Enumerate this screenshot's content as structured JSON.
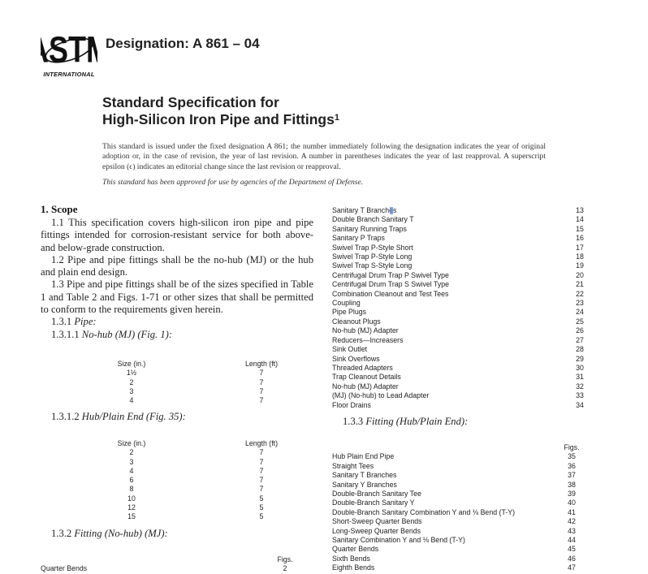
{
  "header": {
    "logo": {
      "name": "astm-logo",
      "caption": "INTERNATIONAL"
    },
    "designation": "Designation: A 861 – 04"
  },
  "title": {
    "line1": "Standard Specification for",
    "line2": "High-Silicon Iron Pipe and Fittings",
    "footnote": "1"
  },
  "notice": "This standard is issued under the fixed designation A 861; the number immediately following the designation indicates the year of original adoption or, in the case of revision, the year of last revision. A number in parentheses indicates the year of last reapproval. A superscript epsilon (ϵ) indicates an editorial change since the last revision or reapproval.",
  "approved": "This standard has been approved for use by agencies of the Department of Defense.",
  "scope": {
    "heading": "1. Scope",
    "p1": "1.1 This specification covers high-silicon iron pipe and pipe fittings intended for corrosion-resistant service for both above- and below-grade construction.",
    "p2": "1.2 Pipe and pipe fittings shall be the no-hub (MJ) or the hub and plain end design.",
    "p3": "1.3 Pipe and pipe fittings shall be of the sizes specified in Table 1 and Table 2 and Figs. 1-71 or other sizes that shall be permitted to conform to the requirements given herein.",
    "s131_num": "1.3.1",
    "s131_label": "Pipe:",
    "s1311_num": "1.3.1.1",
    "s1311_label": "No-hub (MJ) (Fig. 1):",
    "s1312_num": "1.3.1.2",
    "s1312_label": "Hub/Plain End (Fig. 35):",
    "s132_num": "1.3.2",
    "s132_label": "Fitting (No-hub) (MJ):",
    "s133_num": "1.3.3",
    "s133_label": "Fitting (Hub/Plain End):"
  },
  "table_nohub": {
    "headers": [
      "Size (in.)",
      "Length (ft)"
    ],
    "rows": [
      [
        "1½",
        "7"
      ],
      [
        "2",
        "7"
      ],
      [
        "3",
        "7"
      ],
      [
        "4",
        "7"
      ]
    ]
  },
  "table_hub": {
    "headers": [
      "Size (in.)",
      "Length (ft)"
    ],
    "rows": [
      [
        "2",
        "7"
      ],
      [
        "3",
        "7"
      ],
      [
        "4",
        "7"
      ],
      [
        "6",
        "7"
      ],
      [
        "8",
        "7"
      ],
      [
        "10",
        "5"
      ],
      [
        "12",
        "5"
      ],
      [
        "15",
        "5"
      ]
    ]
  },
  "fitting_nohub_left": {
    "figs_header": "Figs.",
    "rows": [
      [
        "Quarter Bends",
        "2"
      ]
    ]
  },
  "fitting_nohub_right": {
    "rows": [
      [
        "Sanitary T Branches",
        "13"
      ],
      [
        "Double Branch Sanitary T",
        "14"
      ],
      [
        "Sanitary Running Traps",
        "15"
      ],
      [
        "Sanitary P Traps",
        "16"
      ],
      [
        "Swivel Trap P-Style Short",
        "17"
      ],
      [
        "Swivel Trap P-Style Long",
        "18"
      ],
      [
        "Swivel Trap S-Style Long",
        "19"
      ],
      [
        "Centrifugal Drum Trap P Swivel Type",
        "20"
      ],
      [
        "Centrifugal Drum Trap S Swivel Type",
        "21"
      ],
      [
        "Combination Cleanout and Test Tees",
        "22"
      ],
      [
        "Coupling",
        "23"
      ],
      [
        "Pipe Plugs",
        "24"
      ],
      [
        "Cleanout Plugs",
        "25"
      ],
      [
        "No-hub (MJ) Adapter",
        "26"
      ],
      [
        "Reducers—Increasers",
        "27"
      ],
      [
        "Sink Outlet",
        "28"
      ],
      [
        "Sink Overflows",
        "29"
      ],
      [
        "Threaded Adapters",
        "30"
      ],
      [
        "Trap Cleanout Details",
        "31"
      ],
      [
        "No-hub (MJ) Adapter",
        "32"
      ],
      [
        "(MJ) (No-hub) to Lead Adapter",
        "33"
      ],
      [
        "Floor Drains",
        "34"
      ]
    ]
  },
  "fitting_hub": {
    "figs_header": "Figs.",
    "rows": [
      [
        "Hub Plain End Pipe",
        "35"
      ],
      [
        "Straight Tees",
        "36"
      ],
      [
        "Sanitary T Branches",
        "37"
      ],
      [
        "Sanitary Y Branches",
        "38"
      ],
      [
        "Double-Branch Sanitary Tee",
        "39"
      ],
      [
        "Double-Branch Sanitary Y",
        "40"
      ],
      [
        "Double-Branch Sanitary Combination Y and ⅛ Bend (T-Y)",
        "41"
      ],
      [
        "Short-Sweep Quarter Bends",
        "42"
      ],
      [
        "Long-Sweep Quarter Bends",
        "43"
      ],
      [
        "Sanitary Combination Y and ⅛ Bend (T-Y)",
        "44"
      ],
      [
        "Quarter Bends",
        "45"
      ],
      [
        "Sixth Bends",
        "46"
      ],
      [
        "Eighth Bends",
        "47"
      ]
    ]
  }
}
